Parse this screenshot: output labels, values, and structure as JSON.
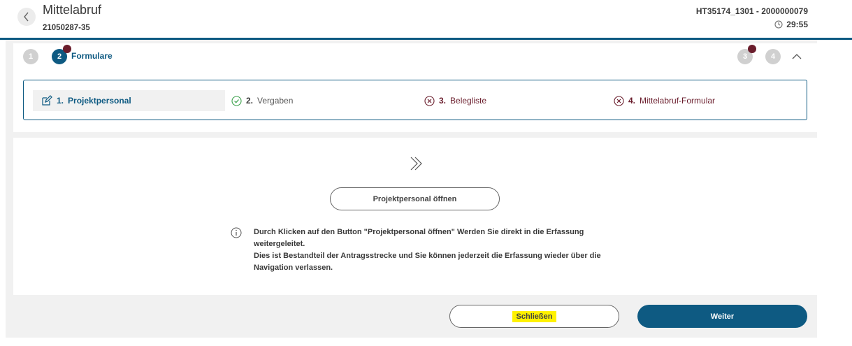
{
  "header": {
    "title": "Mittelabruf",
    "subtitle": "21050287-35",
    "reference": "HT35174_1301 - 2000000079",
    "timer": "29:55"
  },
  "steps": {
    "items": [
      {
        "number": "1",
        "state": "done"
      },
      {
        "number": "2",
        "label": "Formulare",
        "state": "active",
        "has_alert": true
      },
      {
        "number": "3",
        "state": "pending",
        "has_alert": true
      },
      {
        "number": "4",
        "state": "pending"
      }
    ]
  },
  "sub_steps": [
    {
      "num": "1.",
      "label": "Projektpersonal",
      "status": "editing",
      "icon": "edit-icon"
    },
    {
      "num": "2.",
      "label": "Vergaben",
      "status": "complete",
      "icon": "check-circle-icon"
    },
    {
      "num": "3.",
      "label": "Belegliste",
      "status": "error",
      "icon": "x-circle-icon"
    },
    {
      "num": "4.",
      "label": "Mittelabruf-Formular",
      "status": "error",
      "icon": "x-circle-icon"
    }
  ],
  "content": {
    "open_button": "Projektpersonal öffnen",
    "info_line1": "Durch Klicken auf den Button \"Projektpersonal öffnen\" Werden Sie direkt in die Erfassung weitergeleitet.",
    "info_line2": "Dies ist Bestandteil der Antragsstrecke und Sie können jederzeit die Erfassung wieder über die Navigation verlassen."
  },
  "footer": {
    "close_button": "Schließen",
    "next_button": "Weiter"
  },
  "colors": {
    "primary": "#0e5a82",
    "alert": "#6a1d2c",
    "success": "#3aa04a",
    "highlight": "#fff200"
  }
}
